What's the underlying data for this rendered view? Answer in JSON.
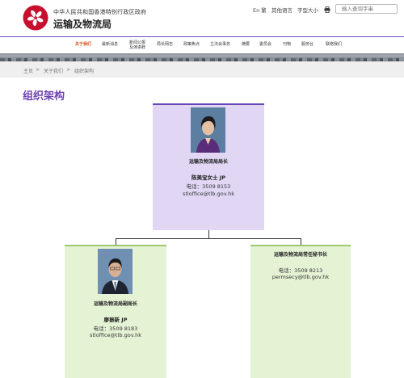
{
  "header": {
    "gov_name": "中华人民共和国香港特别行政区政府",
    "bureau_name": "运输及物流局",
    "lang_switch": "En 繁",
    "other_languages": "其他语言",
    "font_size": "字型大小",
    "search_placeholder": "输入查询字串"
  },
  "nav": {
    "items": [
      {
        "label": "关于我们",
        "active": true
      },
      {
        "label": "最新消息"
      },
      {
        "label": "新闻公报\n及演讲辞"
      },
      {
        "label": "局长网志"
      },
      {
        "label": "政策焦点"
      },
      {
        "label": "立法会事务"
      },
      {
        "label": "摘要"
      },
      {
        "label": "委员会"
      },
      {
        "label": "刊物"
      },
      {
        "label": "服务台"
      },
      {
        "label": "联络我们"
      }
    ]
  },
  "breadcrumb": {
    "items": [
      "主页",
      "关于我们",
      "组织架构"
    ],
    "separator": ">"
  },
  "page_title": "组织架构",
  "org": {
    "secretary": {
      "role": "运输及物流局局长",
      "name": "陈美宝女士 JP",
      "phone": "电话：3509 8153",
      "email": "stloffice@tlb.gov.hk"
    },
    "under_secretary": {
      "role": "运输及物流局副局长",
      "name": "廖振新 JP",
      "phone": "电话：3509 8183",
      "email": "stloffice@tlb.gov.hk"
    },
    "permanent_secretary": {
      "role": "运输及物流局常任秘书长",
      "phone": "电话：3509 8213",
      "email": "permsecy@tlb.gov.hk"
    }
  },
  "colors": {
    "accent_purple": "#7044b4",
    "card_purple": "#e1d7f5",
    "card_green": "#e5f3d5",
    "nav_active": "#d9531e"
  }
}
